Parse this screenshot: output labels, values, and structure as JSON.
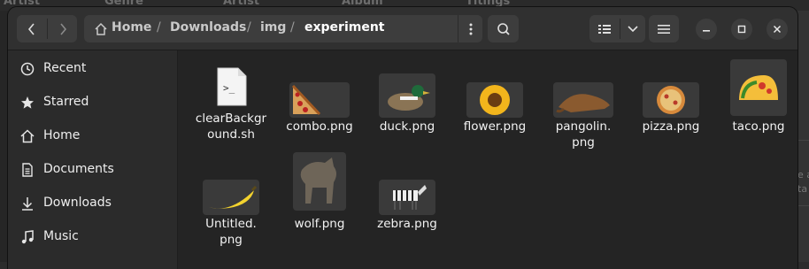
{
  "background_app": {
    "columns": [
      "Artist",
      "Genre",
      "Artist",
      "Album",
      "Titings"
    ],
    "side_text": "e a\nta"
  },
  "window": {
    "pathbar": {
      "crumbs": [
        "Home",
        "Downloads",
        "img",
        "experiment"
      ],
      "separator": "/"
    },
    "controls": {
      "back_icon": "chevron-left",
      "forward_icon": "chevron-right",
      "path_menu_icon": "kebab",
      "search_icon": "magnifier",
      "view_icon": "list-view",
      "view_dropdown_icon": "chevron-down",
      "menu_icon": "hamburger",
      "minimize_icon": "minus",
      "maximize_icon": "square",
      "close_icon": "x"
    }
  },
  "sidebar": {
    "items": [
      {
        "label": "Recent",
        "icon": "clock"
      },
      {
        "label": "Starred",
        "icon": "star"
      },
      {
        "label": "Home",
        "icon": "house"
      },
      {
        "label": "Documents",
        "icon": "document"
      },
      {
        "label": "Downloads",
        "icon": "download-arrow"
      },
      {
        "label": "Music",
        "icon": "music-note"
      }
    ]
  },
  "files": [
    {
      "name": "clearBackground.sh",
      "display": [
        "clearBackgr",
        "ound.sh"
      ],
      "kind": "script"
    },
    {
      "name": "combo.png",
      "display": [
        "combo.png"
      ],
      "kind": "image",
      "subject": "pizza-slice"
    },
    {
      "name": "duck.png",
      "display": [
        "duck.png"
      ],
      "kind": "image",
      "subject": "duck"
    },
    {
      "name": "flower.png",
      "display": [
        "flower.png"
      ],
      "kind": "image",
      "subject": "sunflower"
    },
    {
      "name": "pangolin.png",
      "display": [
        "pangolin.",
        "png"
      ],
      "kind": "image",
      "subject": "pangolin"
    },
    {
      "name": "pizza.png",
      "display": [
        "pizza.png"
      ],
      "kind": "image",
      "subject": "pizza"
    },
    {
      "name": "taco.png",
      "display": [
        "taco.png"
      ],
      "kind": "image",
      "subject": "taco"
    },
    {
      "name": "Untitled.png",
      "display": [
        "Untitled.",
        "png"
      ],
      "kind": "image",
      "subject": "banana"
    },
    {
      "name": "wolf.png",
      "display": [
        "wolf.png"
      ],
      "kind": "image",
      "subject": "wolf"
    },
    {
      "name": "zebra.png",
      "display": [
        "zebra.png"
      ],
      "kind": "image",
      "subject": "zebra"
    }
  ],
  "colors": {
    "window_bg": "#242424",
    "sidebar_bg": "#2b2b2b",
    "header_bg": "#303030",
    "button_bg": "#3d3d3d",
    "text": "#f6f5f4"
  }
}
